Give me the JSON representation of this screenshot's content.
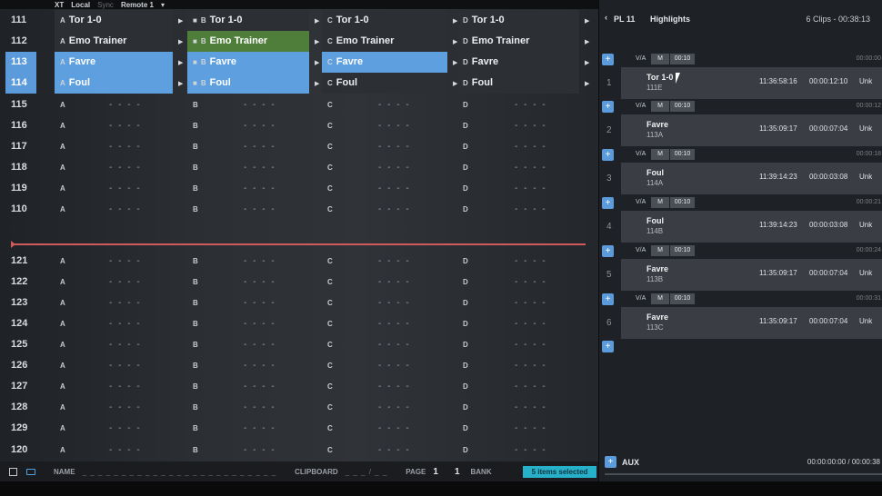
{
  "topbar": {
    "xt": "XT",
    "local": "Local",
    "sync": "Sync",
    "remote": "Remote 1"
  },
  "header_rows": [
    {
      "num": "111",
      "selected": false,
      "cells": [
        {
          "letter": "A",
          "name": "Tor 1-0",
          "style": "dark"
        },
        {
          "letter": "B",
          "name": "Tor 1-0",
          "style": "dark",
          "marker": "■"
        },
        {
          "letter": "C",
          "name": "Tor 1-0",
          "style": "dark"
        },
        {
          "letter": "D",
          "name": "Tor 1-0",
          "style": "dark"
        }
      ]
    },
    {
      "num": "112",
      "selected": false,
      "cells": [
        {
          "letter": "A",
          "name": "Emo Trainer",
          "style": "dark"
        },
        {
          "letter": "B",
          "name": "Emo Trainer",
          "style": "green",
          "marker": "■"
        },
        {
          "letter": "C",
          "name": "Emo Trainer",
          "style": "dark"
        },
        {
          "letter": "D",
          "name": "Emo Trainer",
          "style": "dark"
        }
      ]
    },
    {
      "num": "113",
      "selected": true,
      "cells": [
        {
          "letter": "A",
          "name": "Favre",
          "style": "blue"
        },
        {
          "letter": "B",
          "name": "Favre",
          "style": "blue",
          "marker": "■"
        },
        {
          "letter": "C",
          "name": "Favre",
          "style": "blue"
        },
        {
          "letter": "D",
          "name": "Favre",
          "style": "dark"
        }
      ]
    },
    {
      "num": "114",
      "selected": true,
      "cells": [
        {
          "letter": "A",
          "name": "Foul",
          "style": "blue"
        },
        {
          "letter": "B",
          "name": "Foul",
          "style": "blue",
          "marker": "■"
        },
        {
          "letter": "C",
          "name": "Foul",
          "style": "dark"
        },
        {
          "letter": "D",
          "name": "Foul",
          "style": "dark"
        }
      ]
    }
  ],
  "empty_rows_top": [
    "115",
    "116",
    "117",
    "118",
    "119",
    "110"
  ],
  "empty_rows_bottom": [
    "121",
    "122",
    "123",
    "124",
    "125",
    "126",
    "127",
    "128",
    "129",
    "120"
  ],
  "letters": [
    "A",
    "B",
    "C",
    "D"
  ],
  "dash": "- - - -",
  "bottombar": {
    "name_label": "NAME",
    "name_fill": "_ _ _ _ _ _ _ _ _ _ _ _ _ _ _ _ _ _ _ _ _ _ _ _ _",
    "clipboard_label": "CLIPBOARD",
    "clipboard_fill": "_ _ _ / _ _",
    "page_label": "PAGE",
    "page_value": "1",
    "page_value2": "1",
    "bank_label": "BANK",
    "selected_badge": "5 items selected"
  },
  "playlist": {
    "pl": "PL 11",
    "title": "Highlights",
    "meta": "6 Clips - 00:38:13",
    "clips": [
      {
        "idx": "1",
        "name": "Tor 1-0",
        "sub": "111E",
        "time": "11:36:58:16",
        "dur": "00:00:12:10",
        "unk": "Unk"
      },
      {
        "idx": "2",
        "name": "Favre",
        "sub": "113A",
        "time": "11:35:09:17",
        "dur": "00:00:07:04",
        "unk": "Unk"
      },
      {
        "idx": "3",
        "name": "Foul",
        "sub": "114A",
        "time": "11:39:14:23",
        "dur": "00:00:03:08",
        "unk": "Unk"
      },
      {
        "idx": "4",
        "name": "Foul",
        "sub": "114B",
        "time": "11:39:14:23",
        "dur": "00:00:03:08",
        "unk": "Unk"
      },
      {
        "idx": "5",
        "name": "Favre",
        "sub": "113B",
        "time": "11:35:09:17",
        "dur": "00:00:07:04",
        "unk": "Unk"
      },
      {
        "idx": "6",
        "name": "Favre",
        "sub": "113C",
        "time": "11:35:09:17",
        "dur": "00:00:07:04",
        "unk": "Unk"
      }
    ],
    "transitions": [
      {
        "va": "V/A",
        "mode": "M",
        "dur": "00:10",
        "tc": "00:00:00"
      },
      {
        "va": "V/A",
        "mode": "M",
        "dur": "00:10",
        "tc": "00:00:12"
      },
      {
        "va": "V/A",
        "mode": "M",
        "dur": "00:10",
        "tc": "00:00:18"
      },
      {
        "va": "V/A",
        "mode": "M",
        "dur": "00:10",
        "tc": "00:00:21"
      },
      {
        "va": "V/A",
        "mode": "M",
        "dur": "00:10",
        "tc": "00:00:24"
      },
      {
        "va": "V/A",
        "mode": "M",
        "dur": "00:10",
        "tc": "00:00:31"
      }
    ],
    "aux_label": "AUX",
    "aux_tc": "00:00:00:00 / 00:00:38"
  }
}
